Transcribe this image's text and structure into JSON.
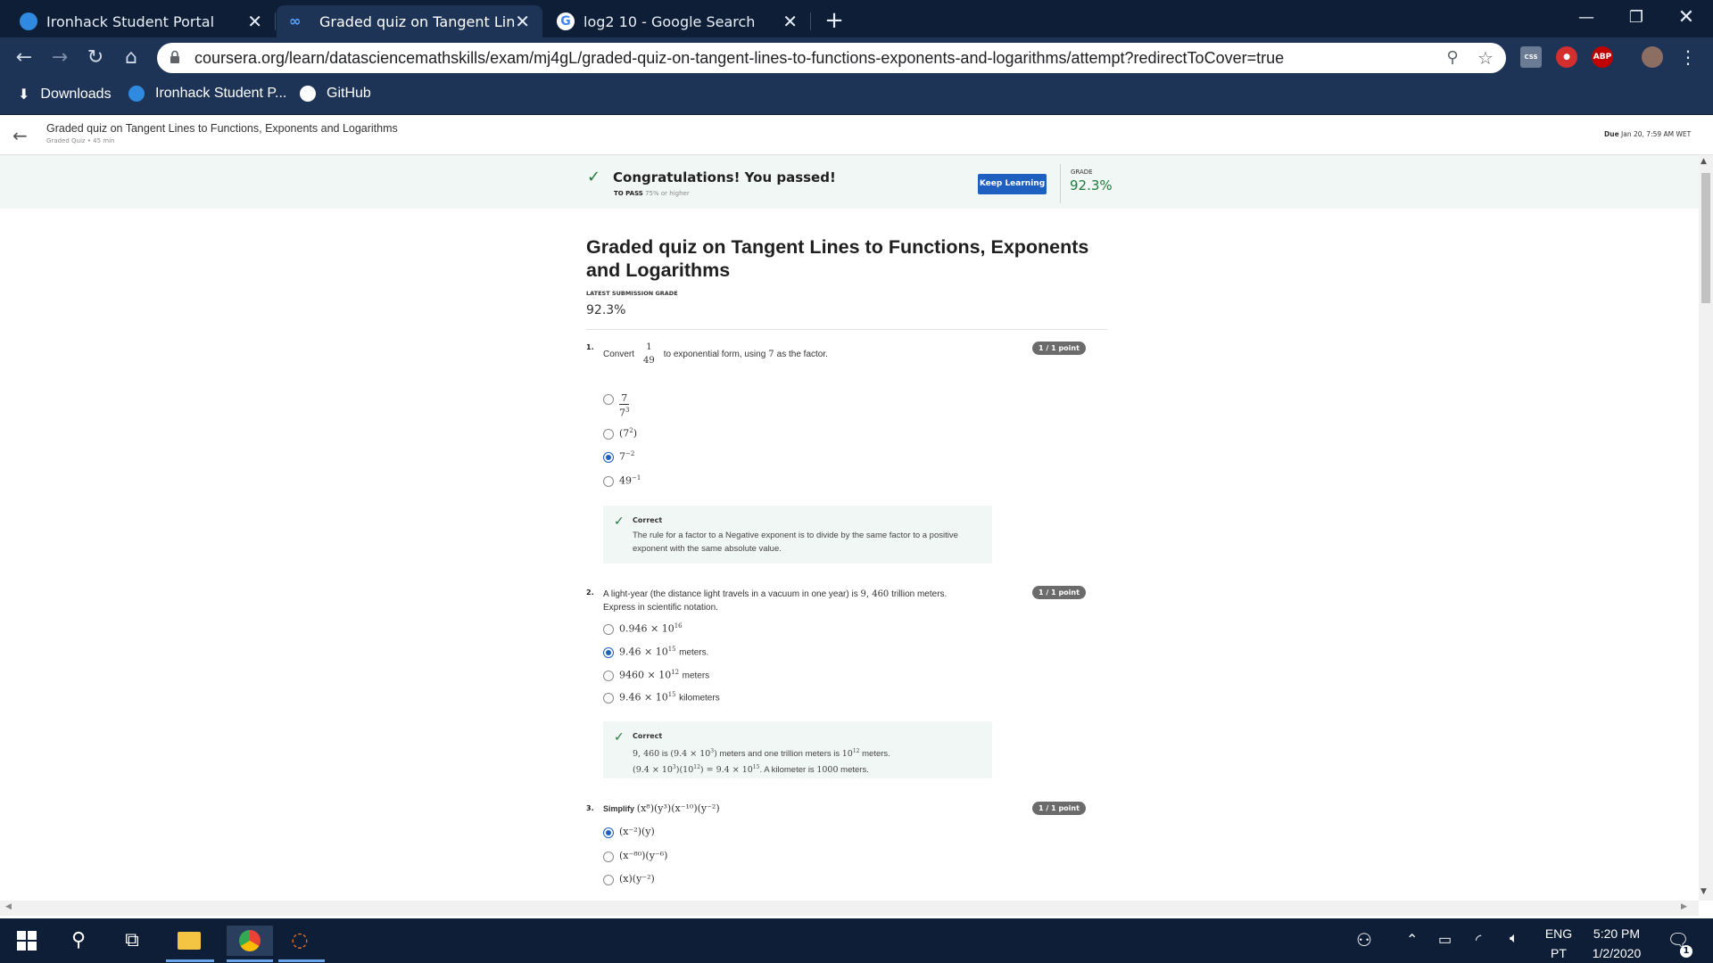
{
  "browser": {
    "tabs": [
      {
        "title": "Ironhack Student Portal",
        "icon": "ironhack-icon"
      },
      {
        "title": "Graded quiz on Tangent Lines to",
        "icon": "coursera-icon"
      },
      {
        "title": "log2 10 - Google Search",
        "icon": "google-icon"
      }
    ],
    "new_tab": "+",
    "url": "coursera.org/learn/datasciencemathskills/exam/mj4gL/graded-quiz-on-tangent-lines-to-functions-exponents-and-logarithms/attempt?redirectToCover=true",
    "extensions": {
      "abp": "ABP",
      "css": "CSS"
    },
    "bookmarks": [
      {
        "label": "Downloads",
        "icon": "download-icon"
      },
      {
        "label": "Ironhack Student P...",
        "icon": "ironhack-icon"
      },
      {
        "label": "GitHub",
        "icon": "github-icon"
      }
    ]
  },
  "course_header": {
    "title": "Graded quiz on Tangent Lines to Functions, Exponents and Logarithms",
    "subtitle": "Graded Quiz • 45 min",
    "due_label": "Due",
    "due_value": "Jan 20, 7:59 AM WET"
  },
  "banner": {
    "message": "Congratulations! You passed!",
    "to_pass_label": "TO PASS",
    "to_pass_value": "75% or higher",
    "button": "Keep Learning",
    "grade_label": "GRADE",
    "grade_value": "92.3%"
  },
  "quiz": {
    "title_line1": "Graded quiz on Tangent Lines to Functions, Exponents",
    "title_line2": "and Logarithms",
    "latest_label": "LATEST SUBMISSION GRADE",
    "latest_value": "92.3%",
    "questions": [
      {
        "number": "1.",
        "points": "1 / 1 point",
        "prefix": "Convert",
        "frac_num": "1",
        "frac_den": "49",
        "suffix": "to exponential form, using",
        "var": "7",
        "suffix2": "as the factor.",
        "options": [
          {
            "num": "7",
            "den_base": "7",
            "den_exp": "3"
          },
          {
            "base": "(7",
            "exp": "2",
            "close": ")"
          },
          {
            "base": "7",
            "exp": "−2"
          },
          {
            "base": "49",
            "exp": "−1"
          }
        ],
        "feedback_title": "Correct",
        "feedback_body": "The rule for a factor to a Negative exponent is to divide by the same factor to a positive exponent with the same absolute value."
      },
      {
        "number": "2.",
        "points": "1 / 1 point",
        "line1_a": "A light-year (the distance light travels in a vacuum in one year) is",
        "line1_val": "9, 460",
        "line1_b": "trillion meters.",
        "line2": "Express in scientific notation.",
        "options": [
          {
            "base": "0.946 × 10",
            "exp": "16",
            "unit": ""
          },
          {
            "base": "9.46 × 10",
            "exp": "15",
            "unit": "meters."
          },
          {
            "base": "9460 × 10",
            "exp": "12",
            "unit": "meters"
          },
          {
            "base": "9.46 × 10",
            "exp": "15",
            "unit": "kilometers"
          }
        ],
        "feedback_title": "Correct",
        "fb_l1_a": "9, 460",
        "fb_l1_b": "is",
        "fb_l1_c": "(9.4 × 10",
        "fb_l1_c_exp": "3",
        "fb_l1_c_close": ")",
        "fb_l1_d": "meters and one trillion meters is",
        "fb_l1_e": "10",
        "fb_l1_e_exp": "12",
        "fb_l1_f": "meters.",
        "fb_l2_a": "(9.4 × 10",
        "fb_l2_a_exp": "3",
        "fb_l2_b": ")(10",
        "fb_l2_b_exp": "12",
        "fb_l2_c": ") = 9.4 × 10",
        "fb_l2_c_exp": "15",
        "fb_l2_d": ". A kilometer is",
        "fb_l2_e": "1000",
        "fb_l2_f": "meters."
      },
      {
        "number": "3.",
        "points": "1 / 1 point",
        "prefix": "Simplify",
        "expr": "(x⁸)(y³)(x⁻¹⁰)(y⁻²)",
        "options": [
          {
            "text": "(x⁻²)(y)"
          },
          {
            "text": "(x⁻⁸⁰)(y⁻⁶)"
          },
          {
            "text": "(x)(y⁻²)"
          }
        ]
      }
    ]
  },
  "taskbar": {
    "lang_top": "ENG",
    "lang_bottom": "PT",
    "time": "5:20 PM",
    "date": "1/2/2020",
    "notif_count": "1"
  },
  "colors": {
    "accent": "#1f5fbf",
    "success": "#1e7a3c",
    "chrome_dark": "#0e1e36",
    "chrome": "#1d3457"
  }
}
